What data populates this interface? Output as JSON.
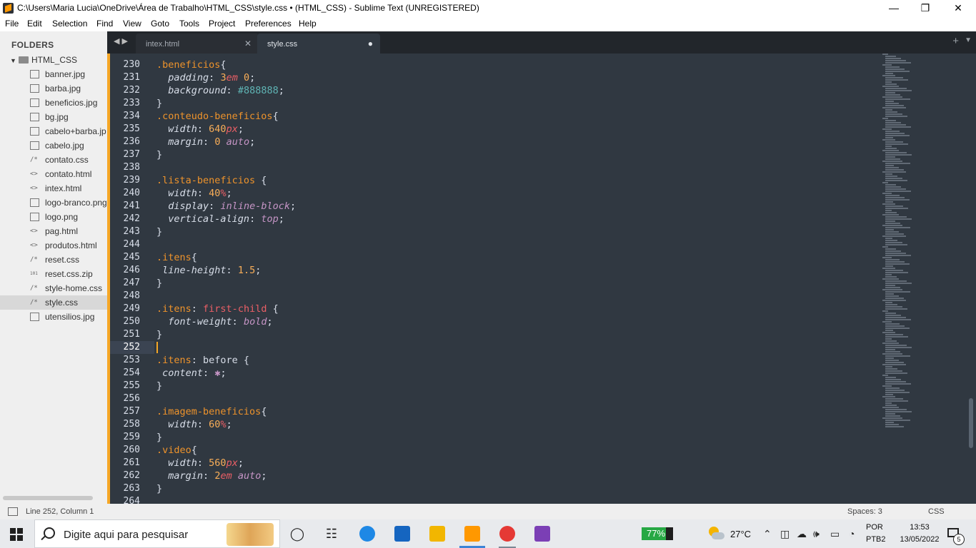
{
  "window": {
    "title": "C:\\Users\\Maria Lucia\\OneDrive\\Área de Trabalho\\HTML_CSS\\style.css • (HTML_CSS) - Sublime Text (UNREGISTERED)",
    "minimize_glyph": "—",
    "maximize_glyph": "❐",
    "close_glyph": "✕"
  },
  "menu": [
    "File",
    "Edit",
    "Selection",
    "Find",
    "View",
    "Goto",
    "Tools",
    "Project",
    "Preferences",
    "Help"
  ],
  "sidebar": {
    "header": "FOLDERS",
    "folder": "HTML_CSS",
    "files": [
      {
        "name": "banner.jpg",
        "icon": "image-file-icon",
        "glyph": ""
      },
      {
        "name": "barba.jpg",
        "icon": "image-file-icon",
        "glyph": ""
      },
      {
        "name": "beneficios.jpg",
        "icon": "image-file-icon",
        "glyph": ""
      },
      {
        "name": "bg.jpg",
        "icon": "image-file-icon",
        "glyph": ""
      },
      {
        "name": "cabelo+barba.jp",
        "icon": "image-file-icon",
        "glyph": ""
      },
      {
        "name": "cabelo.jpg",
        "icon": "image-file-icon",
        "glyph": ""
      },
      {
        "name": "contato.css",
        "icon": "css-file-icon",
        "glyph": "/*"
      },
      {
        "name": "contato.html",
        "icon": "html-file-icon",
        "glyph": "<>"
      },
      {
        "name": "intex.html",
        "icon": "html-file-icon",
        "glyph": "<>"
      },
      {
        "name": "logo-branco.png",
        "icon": "image-file-icon",
        "glyph": ""
      },
      {
        "name": "logo.png",
        "icon": "image-file-icon",
        "glyph": ""
      },
      {
        "name": "pag.html",
        "icon": "html-file-icon",
        "glyph": "<>"
      },
      {
        "name": "produtos.html",
        "icon": "html-file-icon",
        "glyph": "<>"
      },
      {
        "name": "reset.css",
        "icon": "css-file-icon",
        "glyph": "/*"
      },
      {
        "name": "reset.css.zip",
        "icon": "binary-file-icon",
        "glyph": "101"
      },
      {
        "name": "style-home.css",
        "icon": "css-file-icon",
        "glyph": "/*"
      },
      {
        "name": "style.css",
        "icon": "css-file-icon",
        "glyph": "/*",
        "active": true
      },
      {
        "name": "utensilios.jpg",
        "icon": "image-file-icon",
        "glyph": ""
      }
    ]
  },
  "tabs": [
    {
      "label": "intex.html",
      "marker": "✕",
      "active": false
    },
    {
      "label": "style.css",
      "marker": "●",
      "active": true
    }
  ],
  "tabbar": {
    "nav": "◀ ▶",
    "new_tab": "+",
    "menu": "▼"
  },
  "editor": {
    "current_line": 252,
    "lines": [
      {
        "n": "230",
        "t": ".beneficios{"
      },
      {
        "n": "231",
        "t": "  padding: 3em 0;"
      },
      {
        "n": "232",
        "t": "  background: #888888;"
      },
      {
        "n": "233",
        "t": "}"
      },
      {
        "n": "234",
        "t": ".conteudo-beneficios{"
      },
      {
        "n": "235",
        "t": "  width: 640px;"
      },
      {
        "n": "236",
        "t": "  margin: 0 auto;"
      },
      {
        "n": "237",
        "t": "}"
      },
      {
        "n": "238",
        "t": ""
      },
      {
        "n": "239",
        "t": ".lista-beneficios {"
      },
      {
        "n": "240",
        "t": "  width: 40%;"
      },
      {
        "n": "241",
        "t": "  display: inline-block;"
      },
      {
        "n": "242",
        "t": "  vertical-align: top;"
      },
      {
        "n": "243",
        "t": "}"
      },
      {
        "n": "244",
        "t": ""
      },
      {
        "n": "245",
        "t": ".itens{"
      },
      {
        "n": "246",
        "t": " line-height: 1.5;"
      },
      {
        "n": "247",
        "t": "}"
      },
      {
        "n": "248",
        "t": ""
      },
      {
        "n": "249",
        "t": ".itens: first-child {"
      },
      {
        "n": "250",
        "t": "  font-weight: bold;"
      },
      {
        "n": "251",
        "t": "}"
      },
      {
        "n": "252",
        "t": ""
      },
      {
        "n": "253",
        "t": ".itens: before {"
      },
      {
        "n": "254",
        "t": " content: ✱;"
      },
      {
        "n": "255",
        "t": "}"
      },
      {
        "n": "256",
        "t": ""
      },
      {
        "n": "257",
        "t": ".imagem-beneficios{"
      },
      {
        "n": "258",
        "t": "  width: 60%;"
      },
      {
        "n": "259",
        "t": "}"
      },
      {
        "n": "260",
        "t": ".video{"
      },
      {
        "n": "261",
        "t": "  width: 560px;"
      },
      {
        "n": "262",
        "t": "  margin: 2em auto;"
      },
      {
        "n": "263",
        "t": "}"
      },
      {
        "n": "264",
        "t": ""
      }
    ]
  },
  "statusbar": {
    "position": "Line 252, Column 1",
    "indent": "Spaces: 3",
    "syntax": "CSS"
  },
  "taskbar": {
    "search_placeholder": "Digite aqui para pesquisar",
    "battery_percent": 77,
    "battery_label": "77%",
    "temperature": "27°C",
    "lang_line1": "POR",
    "lang_line2": "PTB2",
    "time": "13:53",
    "date": "13/05/2022",
    "notifications": "5",
    "apps": [
      {
        "name": "task-view-icon",
        "glyph": "◯"
      },
      {
        "name": "widgets-icon",
        "glyph": "☷"
      },
      {
        "name": "edge-icon",
        "glyph": ""
      },
      {
        "name": "mail-icon",
        "glyph": ""
      },
      {
        "name": "file-explorer-icon",
        "glyph": ""
      },
      {
        "name": "sublime-text-icon",
        "glyph": ""
      },
      {
        "name": "chrome-icon",
        "glyph": ""
      },
      {
        "name": "app-icon",
        "glyph": ""
      }
    ]
  },
  "colors": {
    "editor_bg": "#303841",
    "accent": "#f6a726",
    "selector": "#ee932b",
    "number": "#f9ae58",
    "unit": "#ec5f66",
    "keyword": "#c695c6",
    "hex": "#5fb4b4"
  }
}
